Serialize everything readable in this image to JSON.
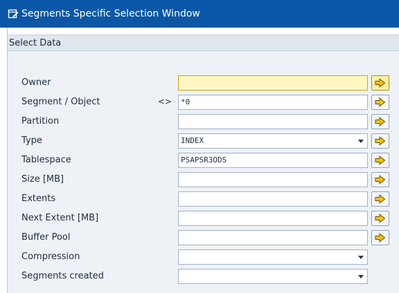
{
  "window": {
    "title": "Segments Specific Selection Window",
    "icon": "window-edit-icon"
  },
  "group": {
    "title": "Select Data"
  },
  "fields": [
    {
      "key": "owner",
      "label": "Owner",
      "value": "",
      "option": "",
      "type": "text",
      "multi": true
    },
    {
      "key": "segment",
      "label": "Segment / Object",
      "value": "*0",
      "option": "<>",
      "type": "text",
      "multi": true
    },
    {
      "key": "partition",
      "label": "Partition",
      "value": "",
      "option": "",
      "type": "text",
      "multi": true
    },
    {
      "key": "type",
      "label": "Type",
      "value": "INDEX",
      "option": "",
      "type": "dropdown",
      "multi": true
    },
    {
      "key": "tablespace",
      "label": "Tablespace",
      "value": "PSAPSR3ODS",
      "option": "",
      "type": "text",
      "multi": true
    },
    {
      "key": "size",
      "label": "Size [MB]",
      "value": "",
      "option": "",
      "type": "text",
      "multi": true
    },
    {
      "key": "extents",
      "label": "Extents",
      "value": "",
      "option": "",
      "type": "text",
      "multi": true
    },
    {
      "key": "next_extent",
      "label": "Next Extent [MB]",
      "value": "",
      "option": "",
      "type": "text",
      "multi": true
    },
    {
      "key": "buffer_pool",
      "label": "Buffer Pool",
      "value": "",
      "option": "",
      "type": "text",
      "multi": true
    },
    {
      "key": "compression",
      "label": "Compression",
      "value": "",
      "option": "",
      "type": "dropdown",
      "multi": false
    },
    {
      "key": "segments_created",
      "label": "Segments created",
      "value": "",
      "option": "",
      "type": "dropdown",
      "multi": false
    }
  ],
  "icons": {
    "multiple_selection": "multiple-selection-arrow-icon",
    "dropdown": "chevron-down-icon"
  },
  "colors": {
    "titlebar": "#0a57a8",
    "required_field": "#fff7c2",
    "focus_marker": "#cf2a2a",
    "group_header": "#dfe6ee",
    "arrow_icon": "#f4c20d"
  }
}
